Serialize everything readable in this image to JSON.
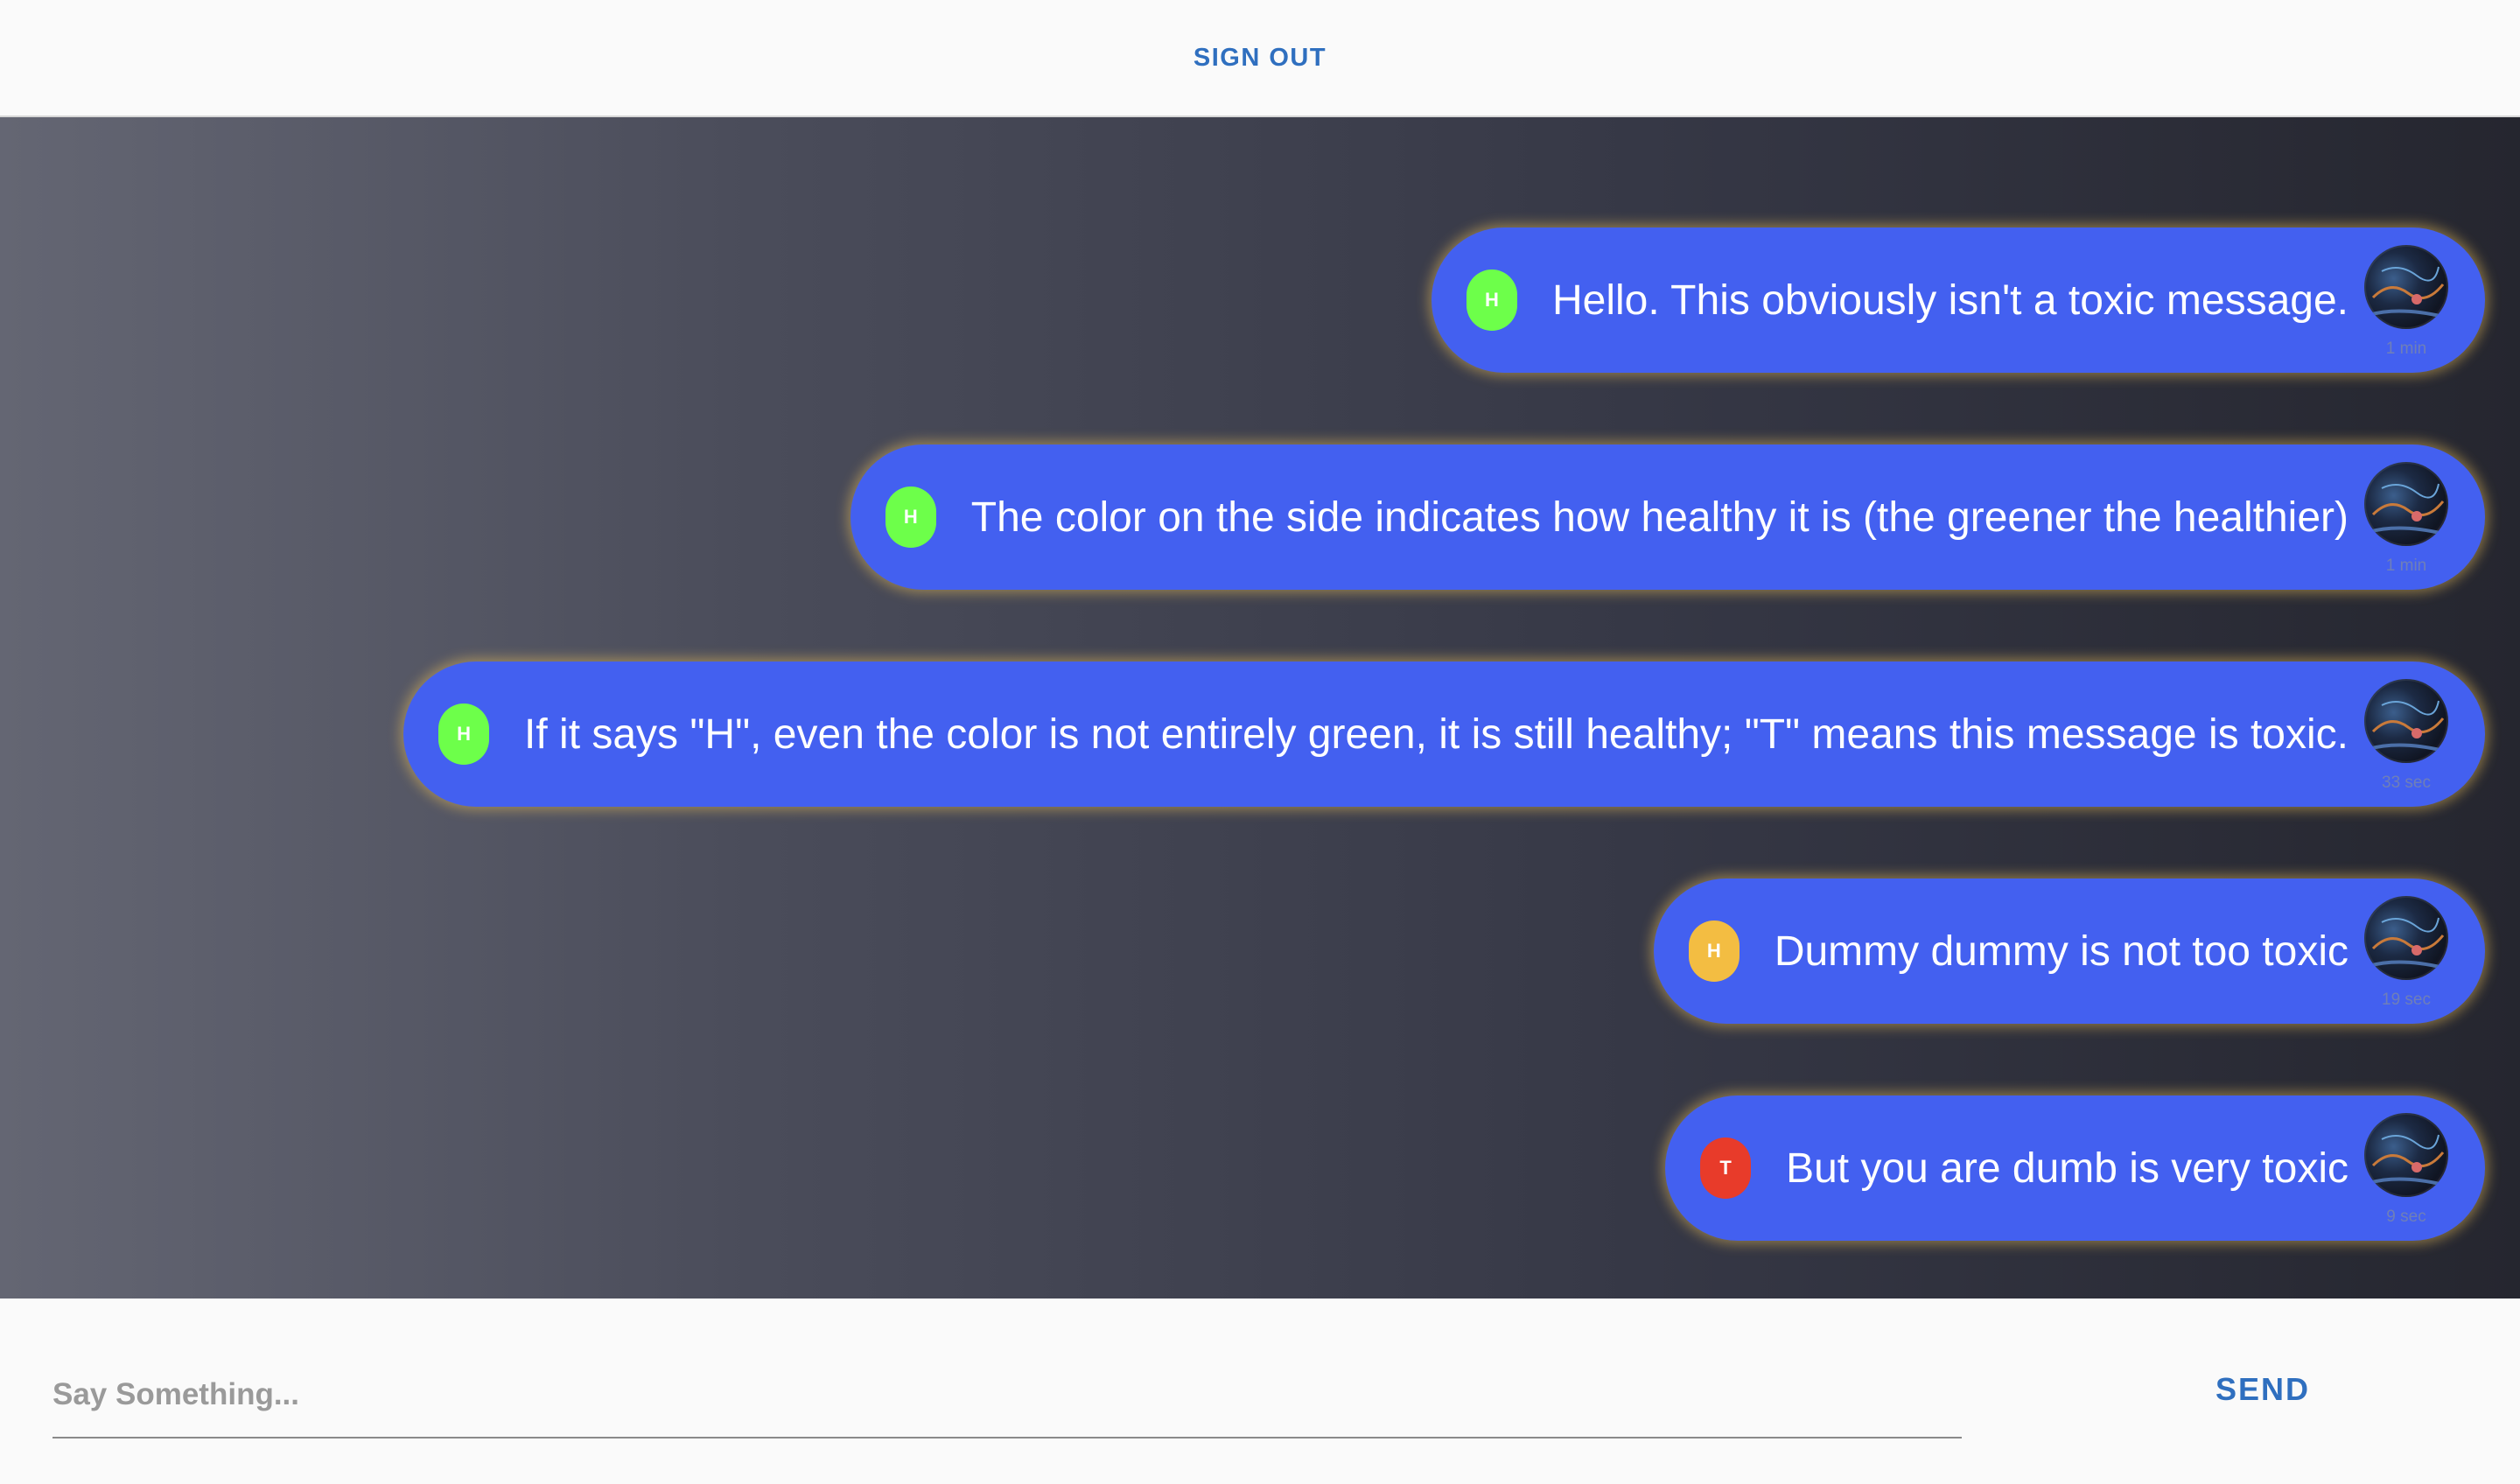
{
  "header": {
    "sign_out_label": "SIGN OUT"
  },
  "messages": [
    {
      "badge": "H",
      "badge_color": "#6dff4a",
      "text": "Hello. This obviously isn't a toxic message.",
      "time": "1 min"
    },
    {
      "badge": "H",
      "badge_color": "#6dff4a",
      "text": "The color on the side indicates how healthy it is (the greener the healthier)",
      "time": "1 min"
    },
    {
      "badge": "H",
      "badge_color": "#6dff4a",
      "text": "If it says \"H\", even the color is not entirely green, it is still healthy; \"T\" means this message is toxic.",
      "time": "33 sec"
    },
    {
      "badge": "H",
      "badge_color": "#f3bd42",
      "text": "Dummy dummy is not too toxic",
      "time": "19 sec"
    },
    {
      "badge": "T",
      "badge_color": "#e83b2a",
      "text": "But you are dumb is very toxic",
      "time": "9 sec"
    }
  ],
  "composer": {
    "placeholder": "Say Something...",
    "value": "",
    "send_label": "SEND"
  },
  "colors": {
    "accent": "#2f6fbf",
    "bubble": "#4360f0"
  }
}
